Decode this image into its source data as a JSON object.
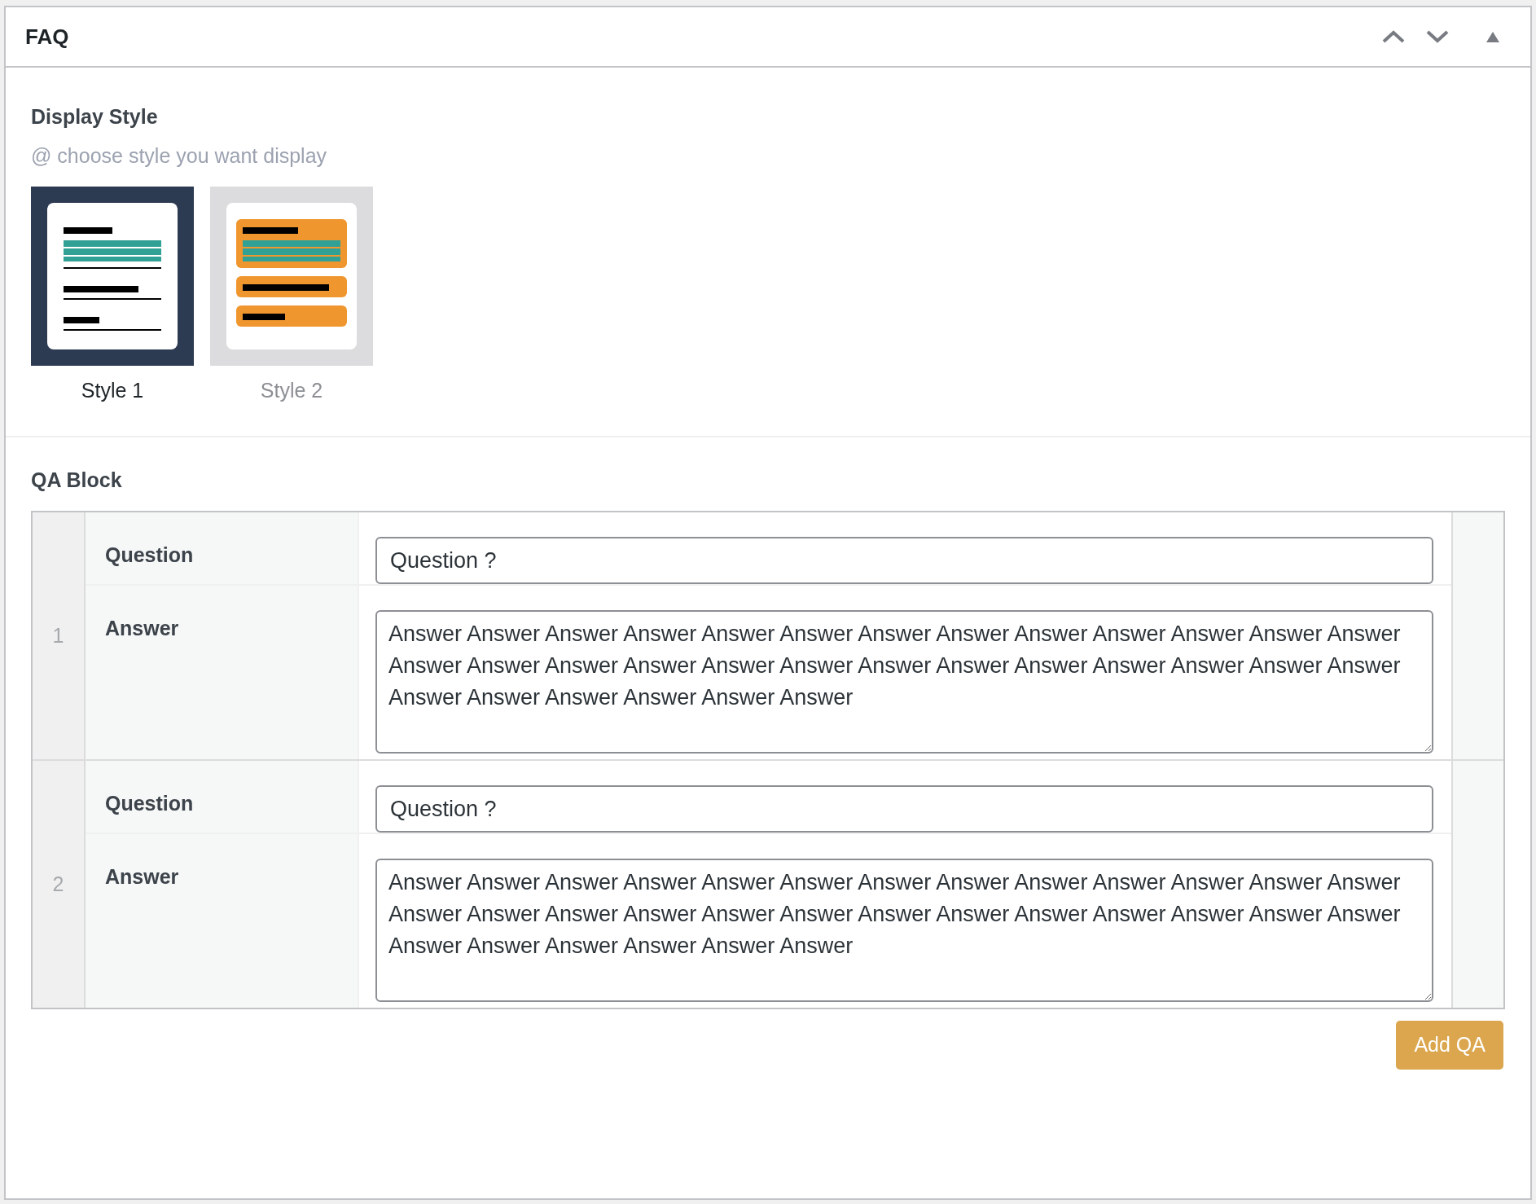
{
  "panel": {
    "title": "FAQ"
  },
  "display_style": {
    "label": "Display Style",
    "hint": "@ choose style you want display",
    "options": [
      {
        "label": "Style 1",
        "kind": "lines",
        "selected": true
      },
      {
        "label": "Style 2",
        "kind": "cards",
        "selected": false
      }
    ]
  },
  "qa_block": {
    "title": "QA Block",
    "items": [
      {
        "number": "1",
        "question_label": "Question",
        "question": "Question ?",
        "answer_label": "Answer",
        "answer": "Answer Answer Answer Answer Answer Answer Answer Answer Answer Answer Answer Answer Answer Answer Answer Answer Answer Answer Answer Answer Answer Answer Answer Answer Answer Answer Answer Answer Answer Answer Answer Answer"
      },
      {
        "number": "2",
        "question_label": "Question",
        "question": "Question ?",
        "answer_label": "Answer",
        "answer": "Answer Answer Answer Answer Answer Answer Answer Answer Answer Answer Answer Answer Answer Answer Answer Answer Answer Answer Answer Answer Answer Answer Answer Answer Answer Answer Answer Answer Answer Answer Answer Answer"
      }
    ],
    "add_button": "Add QA"
  }
}
